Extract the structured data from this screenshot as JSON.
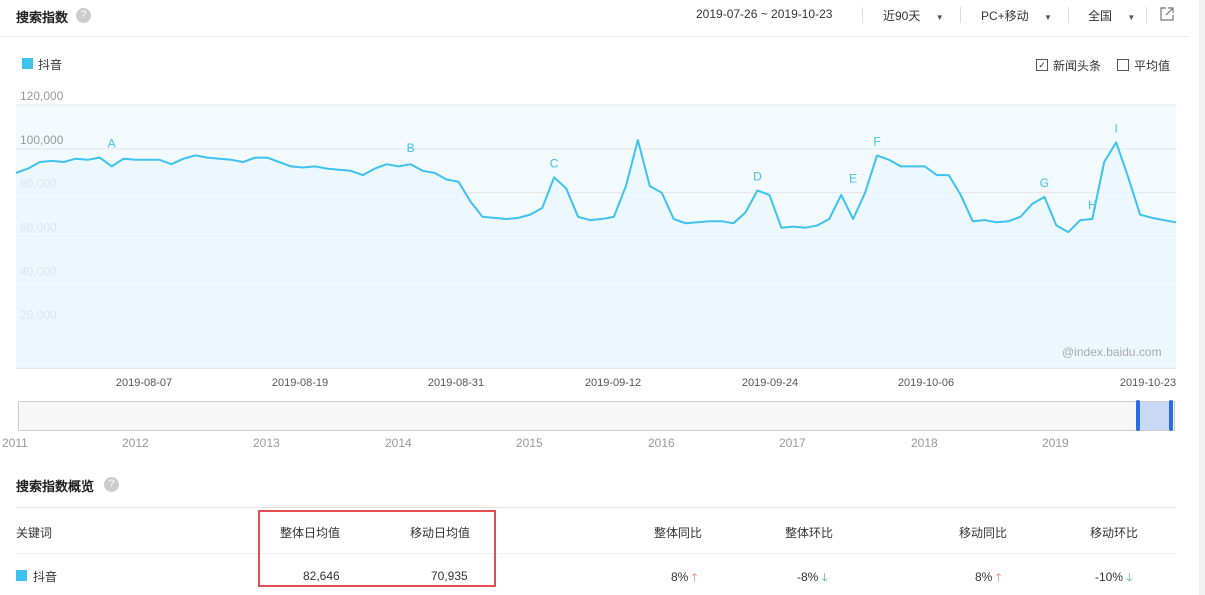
{
  "header": {
    "title": "搜索指数",
    "help_icon": "?",
    "date_range": "2019-07-26 ~ 2019-10-23",
    "period": "近90天",
    "device": "PC+移动",
    "region": "全国"
  },
  "legend": {
    "series_label": "抖音",
    "color": "#3ec2ef"
  },
  "options": {
    "news_label": "新闻头条",
    "news_checked": true,
    "avg_label": "平均值",
    "avg_checked": false
  },
  "watermark": "@index.baidu.com",
  "chart_data": {
    "type": "line",
    "y_ticks": [
      "120,000",
      "100,000",
      "80,000",
      "60,000",
      "40,000",
      "20,000"
    ],
    "ylim": [
      0,
      120000
    ],
    "x_ticks": [
      "2019-08-07",
      "2019-08-19",
      "2019-08-31",
      "2019-09-12",
      "2019-09-24",
      "2019-10-06",
      "2019-10-23"
    ],
    "series": [
      {
        "name": "抖音",
        "color": "#3ec2ef",
        "values": [
          89000,
          91000,
          94000,
          94500,
          94000,
          95500,
          95000,
          96000,
          92000,
          95500,
          95000,
          95000,
          95000,
          93000,
          95500,
          97000,
          96000,
          95500,
          95000,
          94000,
          96000,
          96000,
          94000,
          92000,
          91500,
          92000,
          91000,
          90500,
          90000,
          88000,
          91000,
          93000,
          92000,
          93000,
          90000,
          89000,
          86000,
          85000,
          76000,
          69000,
          68500,
          68000,
          68500,
          70000,
          73000,
          87000,
          82000,
          69000,
          67500,
          68000,
          69000,
          83000,
          104000,
          83000,
          80000,
          68000,
          66000,
          66500,
          67000,
          67000,
          66000,
          71000,
          81000,
          79000,
          64000,
          64500,
          64000,
          65000,
          68000,
          79000,
          68000,
          80000,
          97000,
          95000,
          92000,
          92000,
          92000,
          88000,
          88000,
          79000,
          67000,
          67500,
          66500,
          67000,
          69000,
          75000,
          78000,
          65000,
          62000,
          67500,
          68000,
          94000,
          103000,
          87000,
          70000,
          68500,
          67500,
          66500
        ],
        "annotations": [
          {
            "label": "A",
            "x_index": 8,
            "value": 96000
          },
          {
            "label": "B",
            "x_index": 33,
            "value": 94000
          },
          {
            "label": "C",
            "x_index": 45,
            "value": 87000
          },
          {
            "label": "D",
            "x_index": 62,
            "value": 81000
          },
          {
            "label": "E",
            "x_index": 70,
            "value": 80000
          },
          {
            "label": "F",
            "x_index": 72,
            "value": 97000
          },
          {
            "label": "G",
            "x_index": 86,
            "value": 78000
          },
          {
            "label": "H",
            "x_index": 90,
            "value": 68000
          },
          {
            "label": "I",
            "x_index": 92,
            "value": 103000
          }
        ]
      }
    ],
    "grid": true,
    "legend_position": "top-left"
  },
  "timeline": {
    "years": [
      "2011",
      "2012",
      "2013",
      "2014",
      "2015",
      "2016",
      "2017",
      "2018",
      "2019"
    ]
  },
  "overview": {
    "title": "搜索指数概览",
    "columns": [
      "关键词",
      "整体日均值",
      "移动日均值",
      "整体同比",
      "整体环比",
      "移动同比",
      "移动环比"
    ],
    "row": {
      "keyword": "抖音",
      "overall_avg": "82,646",
      "mobile_avg": "70,935",
      "overall_yoy": "8%",
      "overall_yoy_dir": "up",
      "overall_mom": "-8%",
      "overall_mom_dir": "down",
      "mobile_yoy": "8%",
      "mobile_yoy_dir": "up",
      "mobile_mom": "-10%",
      "mobile_mom_dir": "down"
    }
  }
}
